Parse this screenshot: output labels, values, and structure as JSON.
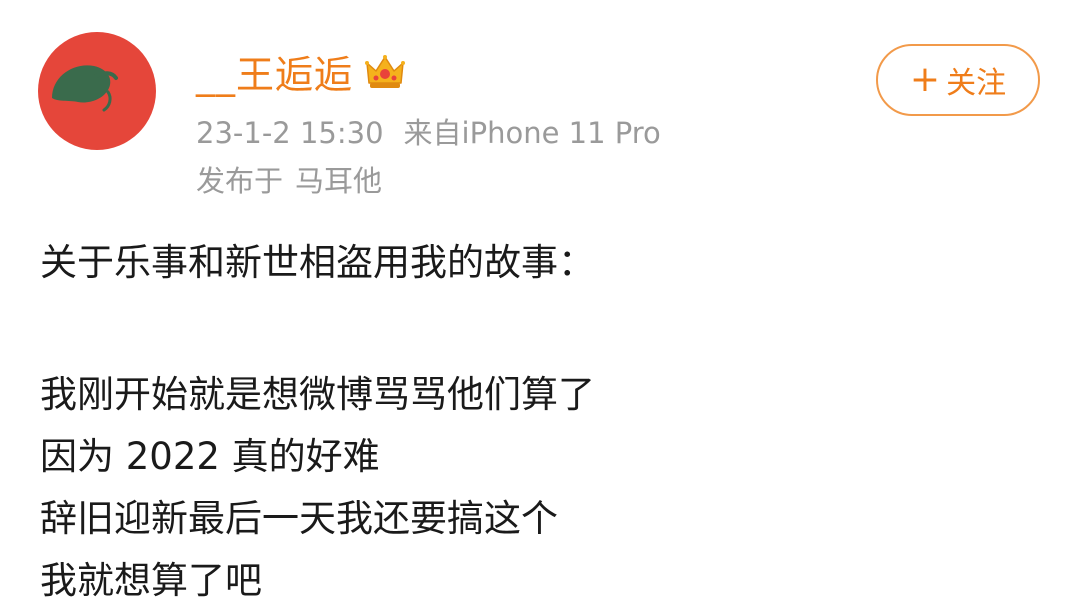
{
  "user": {
    "name": "__王逅逅",
    "badge_icon": "crown-icon",
    "avatar_color": "#e5463a"
  },
  "meta": {
    "time": "23-1-2 15:30",
    "source": "来自iPhone 11 Pro",
    "location_prefix": "发布于",
    "location": "马耳他"
  },
  "follow": {
    "icon": "plus-icon",
    "plus": "+",
    "label": "关注"
  },
  "post": {
    "lines": [
      "关于乐事和新世相盗用我的故事：",
      "",
      "我刚开始就是想微博骂骂他们算了",
      "因为 2022 真的好难",
      "辞旧迎新最后一天我还要搞这个",
      "我就想算了吧"
    ]
  },
  "colors": {
    "accent": "#ef7d1a",
    "meta_gray": "#9a9a9a",
    "text": "#1a1a1a"
  }
}
